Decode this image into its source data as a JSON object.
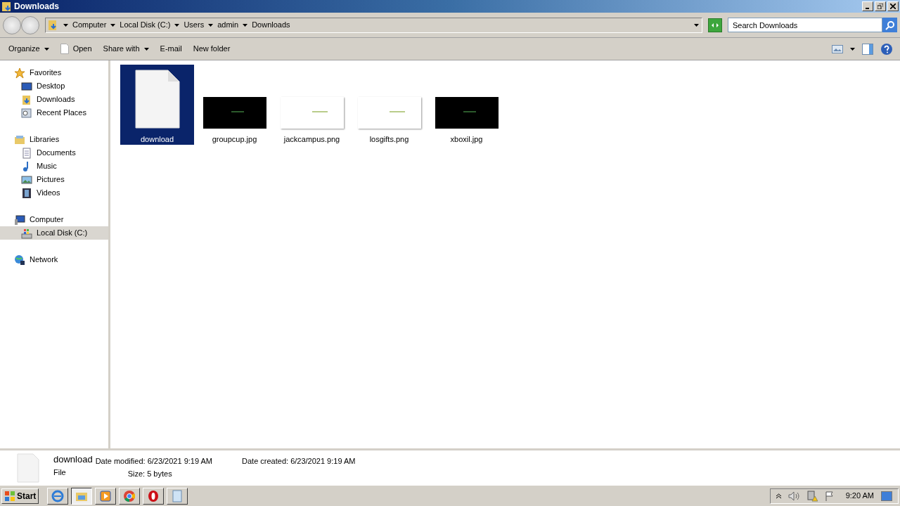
{
  "window": {
    "title": "Downloads"
  },
  "breadcrumb": [
    "Computer",
    "Local Disk (C:)",
    "Users",
    "admin",
    "Downloads"
  ],
  "search": {
    "placeholder": "Search Downloads"
  },
  "toolbar": [
    {
      "label": "Organize",
      "menu": true,
      "kind": "plain"
    },
    {
      "label": "Open",
      "menu": false,
      "kind": "open"
    },
    {
      "label": "Share with",
      "menu": true,
      "kind": "plain"
    },
    {
      "label": "E-mail",
      "menu": false,
      "kind": "plain"
    },
    {
      "label": "New folder",
      "menu": false,
      "kind": "plain"
    }
  ],
  "nav": [
    {
      "label": "Favorites",
      "kind": "star",
      "selected": false,
      "children": [
        {
          "label": "Desktop",
          "kind": "desktop",
          "selected": false
        },
        {
          "label": "Downloads",
          "kind": "folder",
          "selected": false
        },
        {
          "label": "Recent Places",
          "kind": "recent",
          "selected": false
        }
      ]
    },
    {
      "label": "Libraries",
      "kind": "library",
      "selected": false,
      "children": [
        {
          "label": "Documents",
          "kind": "document",
          "selected": false
        },
        {
          "label": "Music",
          "kind": "music",
          "selected": false
        },
        {
          "label": "Pictures",
          "kind": "pictures",
          "selected": false
        },
        {
          "label": "Videos",
          "kind": "videos",
          "selected": false
        }
      ]
    },
    {
      "label": "Computer",
      "kind": "computer",
      "selected": false,
      "children": [
        {
          "label": "Local Disk (C:)",
          "kind": "disk",
          "selected": true
        }
      ]
    },
    {
      "label": "Network",
      "kind": "network",
      "selected": false
    }
  ],
  "files": [
    {
      "name": "download",
      "kind": "blank",
      "selected": true
    },
    {
      "name": "groupcup.jpg",
      "kind": "dark",
      "selected": false
    },
    {
      "name": "jackcampus.png",
      "kind": "light",
      "selected": false
    },
    {
      "name": "losgifts.png",
      "kind": "light",
      "selected": false
    },
    {
      "name": "xboxil.jpg",
      "kind": "dark",
      "selected": false
    }
  ],
  "details": {
    "name": "download",
    "type": "File",
    "fields": [
      {
        "label": "Date modified:",
        "value": "6/23/2021 9:19 AM"
      },
      {
        "label": "Date created:",
        "value": "6/23/2021 9:19 AM"
      },
      {
        "label": "Size:",
        "value": "5 bytes"
      }
    ]
  },
  "taskbar": {
    "start": "Start",
    "apps": [
      {
        "kind": "ie",
        "selected": false
      },
      {
        "kind": "explorer",
        "selected": true
      },
      {
        "kind": "media",
        "selected": false
      },
      {
        "kind": "chrome",
        "selected": false
      },
      {
        "kind": "opera",
        "selected": false
      },
      {
        "kind": "notepad",
        "selected": false
      }
    ],
    "clock": "9:20 AM"
  }
}
